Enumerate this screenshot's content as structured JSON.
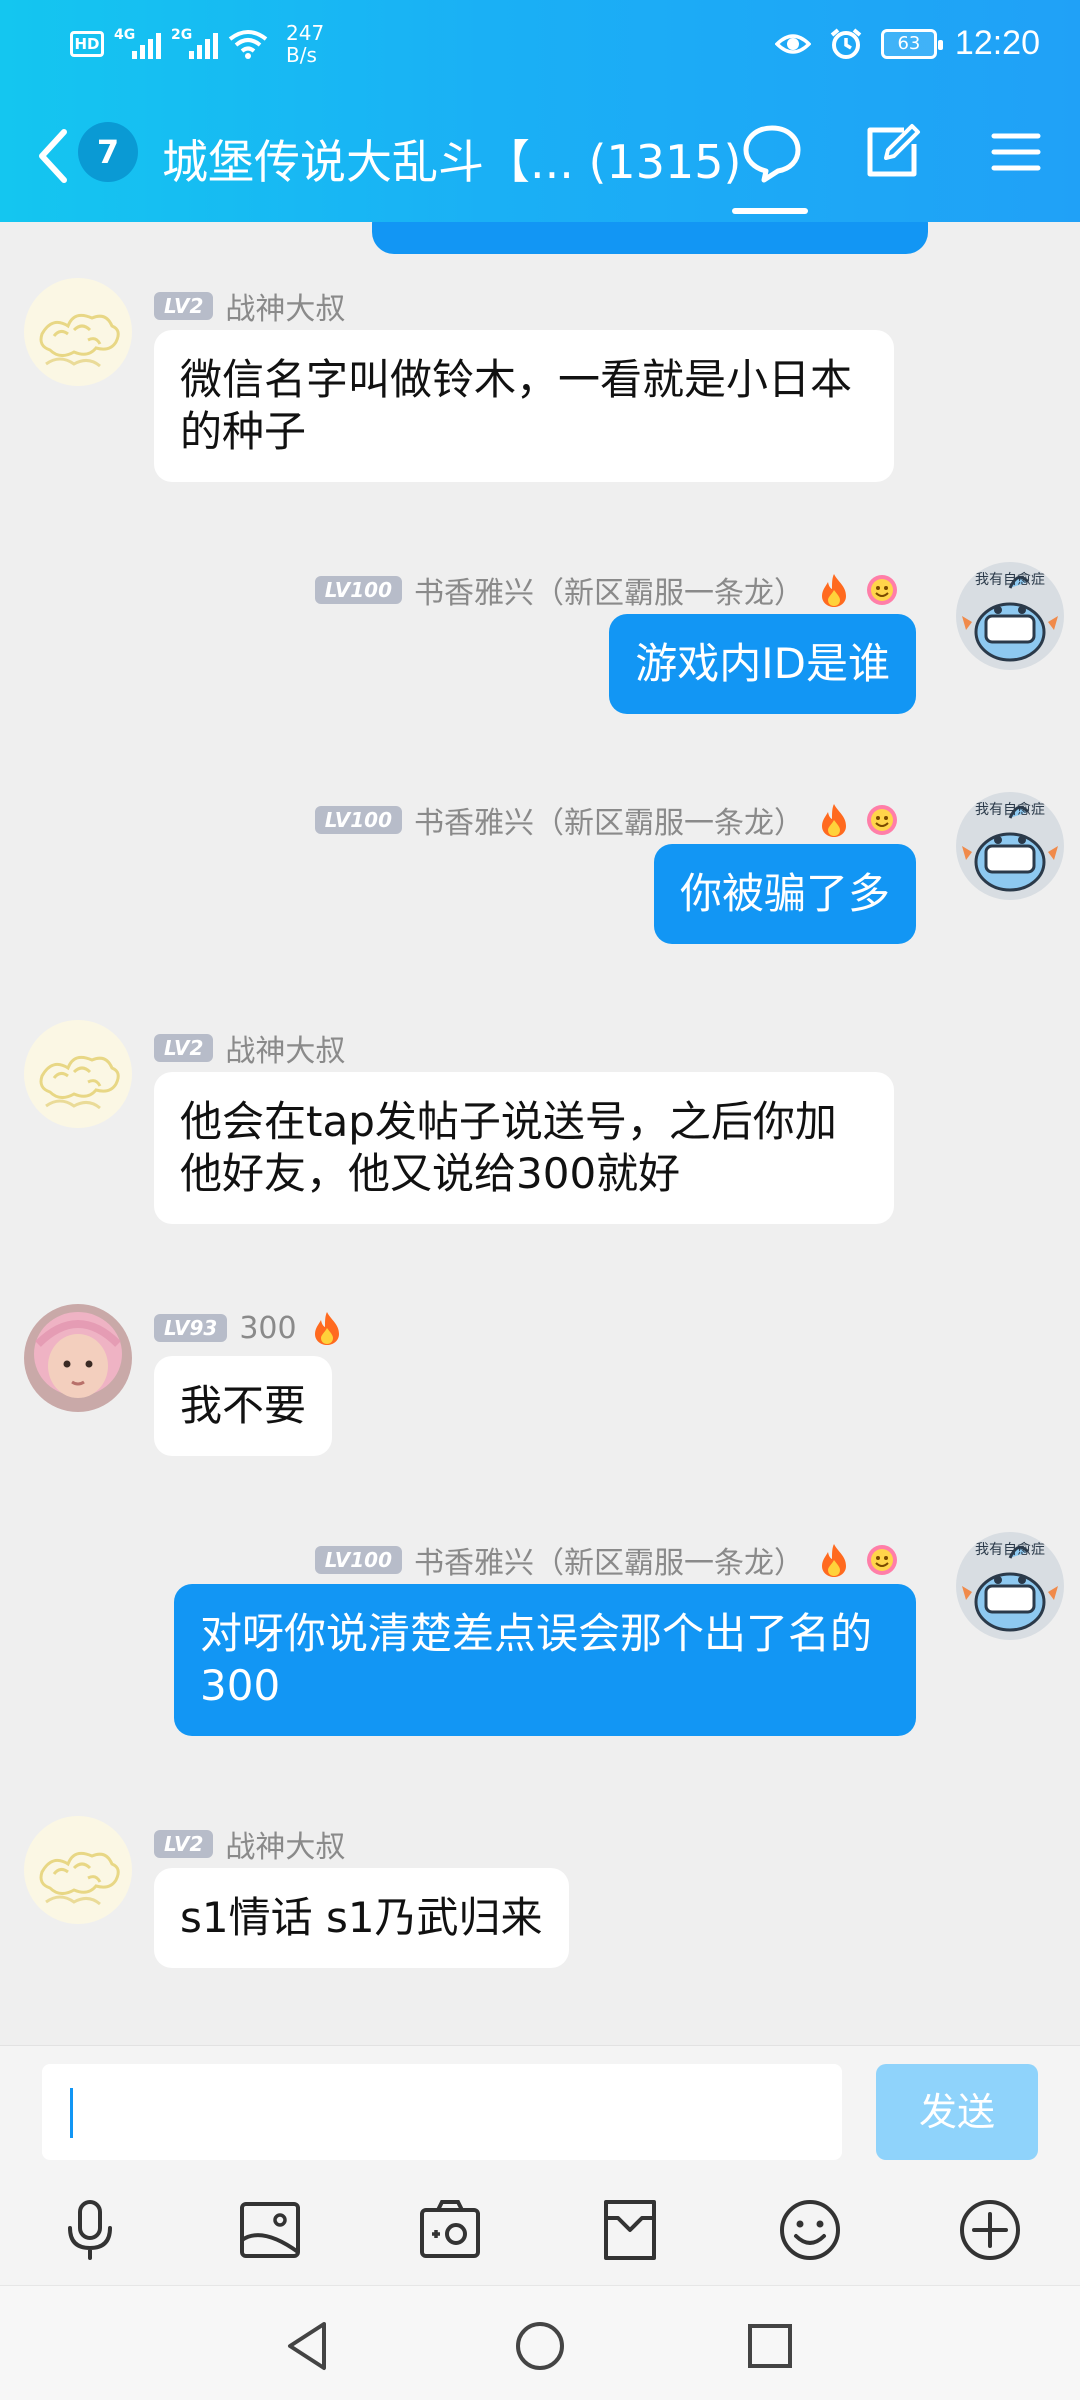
{
  "status_bar": {
    "hd": "HD",
    "net1": "4G",
    "net2": "2G",
    "speed_value": "247",
    "speed_unit": "B/s",
    "battery": "63",
    "time": "12:20"
  },
  "header": {
    "unread_count": "7",
    "title": "城堡传说大乱斗【... (1315)",
    "accent": "#1296f4"
  },
  "messages": [
    {
      "side": "in",
      "level": "LV2",
      "name": "战神大叔",
      "avatar": "cloud-pattern",
      "text": "微信名字叫做铃木，一看就是小日本的种子"
    },
    {
      "side": "out",
      "level": "LV100",
      "name": "书香雅兴（新区霸服一条龙）",
      "avatar": "mudkip-sticker",
      "text": "游戏内ID是谁"
    },
    {
      "side": "out",
      "level": "LV100",
      "name": "书香雅兴（新区霸服一条龙）",
      "avatar": "mudkip-sticker",
      "text": "你被骗了多"
    },
    {
      "side": "in",
      "level": "LV2",
      "name": "战神大叔",
      "avatar": "cloud-pattern",
      "text": "他会在tap发帖子说送号，之后你加他好友，他又说给300就好"
    },
    {
      "side": "in",
      "level": "LV93",
      "name": "300",
      "avatar": "baby-photo",
      "text": "我不要"
    },
    {
      "side": "out",
      "level": "LV100",
      "name": "书香雅兴（新区霸服一条龙）",
      "avatar": "mudkip-sticker",
      "text": "对呀你说清楚差点误会那个出了名的300"
    },
    {
      "side": "in",
      "level": "LV2",
      "name": "战神大叔",
      "avatar": "cloud-pattern",
      "text": "s1情话 s1乃武归来"
    }
  ],
  "avatar_caption": "我有自愈症",
  "composer": {
    "value": "",
    "send_label": "发送"
  },
  "toolbar": [
    "microphone-icon",
    "image-icon",
    "camera-icon",
    "file-icon",
    "emoji-icon",
    "plus-icon"
  ]
}
